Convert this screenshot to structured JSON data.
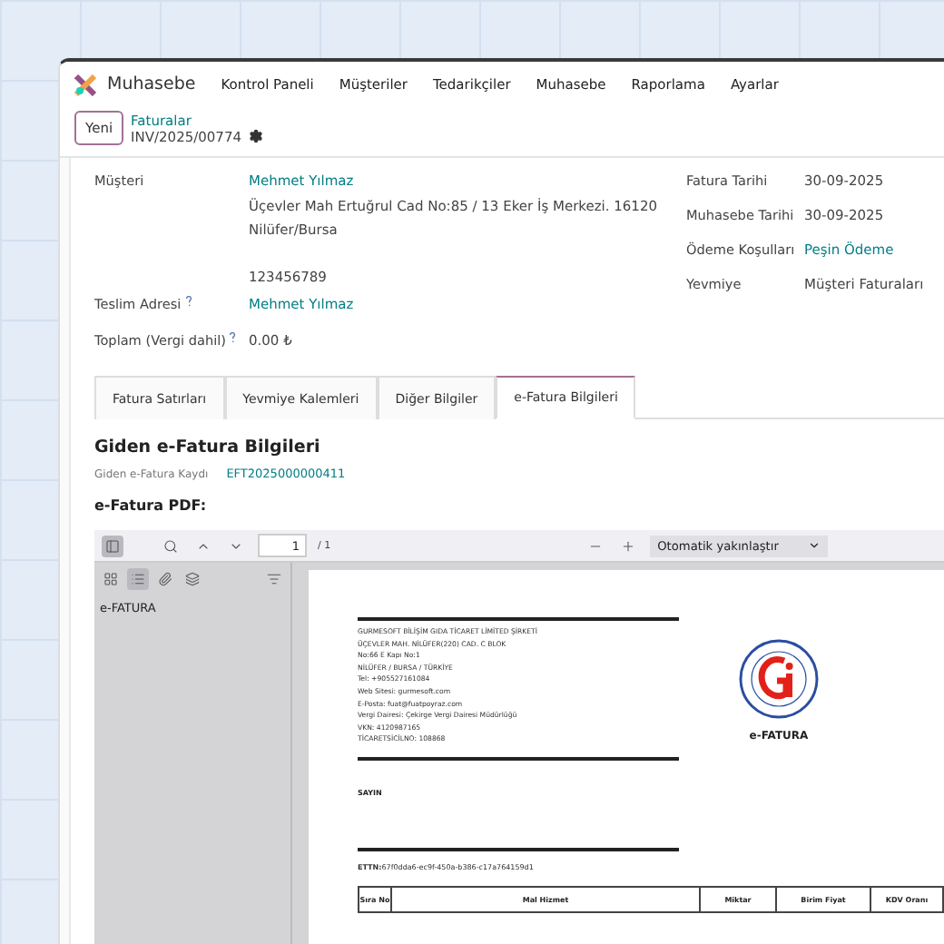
{
  "app": {
    "name": "Muhasebe",
    "menu": [
      "Kontrol Paneli",
      "Müşteriler",
      "Tedarikçiler",
      "Muhasebe",
      "Raporlama",
      "Ayarlar"
    ]
  },
  "breadcrumb": {
    "new_button": "Yeni",
    "parent": "Faturalar",
    "record": "INV/2025/00774"
  },
  "customer": {
    "label": "Müşteri",
    "name": "Mehmet Yılmaz",
    "address_lines": [
      "Üçevler Mah Ertuğrul Cad No:85 / 13 Eker İş Merkezi. 16120",
      "Nilüfer/Bursa"
    ],
    "phone": "123456789"
  },
  "left_fields": [
    {
      "label": "Teslim Adresi",
      "help": true,
      "kind": "link",
      "value": "Mehmet Yılmaz"
    },
    {
      "label": "Toplam (Vergi dahil)",
      "help": true,
      "kind": "text",
      "value": "0.00 ₺"
    }
  ],
  "right_fields": [
    {
      "label": "Fatura Tarihi",
      "kind": "text",
      "value": "30-09-2025"
    },
    {
      "label": "Muhasebe Tarihi",
      "kind": "text",
      "value": "30-09-2025"
    },
    {
      "label": "Ödeme Koşulları",
      "kind": "link",
      "value": "Peşin Ödeme"
    },
    {
      "label": "Yevmiye",
      "kind": "text",
      "value": "Müşteri Faturaları"
    }
  ],
  "tabs": [
    {
      "label": "Fatura Satırları",
      "selected": false
    },
    {
      "label": "Yevmiye Kalemleri",
      "selected": false
    },
    {
      "label": "Diğer Bilgiler",
      "selected": false
    },
    {
      "label": "e-Fatura Bilgileri",
      "selected": true
    }
  ],
  "section": {
    "title": "Giden e-Fatura Bilgileri",
    "record_label": "Giden e-Fatura Kaydı",
    "record_value": "EFT2025000000411",
    "pdf_label": "e-Fatura PDF:"
  },
  "pdf_viewer": {
    "sidebar_open": true,
    "page": "1",
    "page_total": "/ 1",
    "zoom": "Otomatik yakınlaştır",
    "sidebar_views": [
      {
        "kind": "thumbnails",
        "selected": false
      },
      {
        "kind": "outline",
        "selected": true
      },
      {
        "kind": "attachments",
        "selected": false
      },
      {
        "kind": "layers",
        "selected": false
      }
    ],
    "outline": [
      "e-FATURA"
    ]
  },
  "document": {
    "seller_lines": [
      "GURMESOFT BİLİŞİM GIDA TİCARET LİMİTED ŞİRKETİ",
      "ÜÇEVLER MAH. NİLÜFER(220) CAD. C BLOK",
      "No:66 E  Kapı No:1",
      "NİLÜFER / BURSA / TÜRKİYE",
      "Tel:  +905527161084",
      "Web Sitesi: gurmesoft.com",
      "E-Posta: fuat@fuatpoyraz.com",
      "Vergi Dairesi: Çekirge Vergi Dairesi Müdürlüğü",
      "VKN: 4120987165",
      "TİCARETSİCİLNO: 108868"
    ],
    "logo_caption": "e-FATURA",
    "recipient_heading": "SAYIN",
    "ettn_label": "ETTN:",
    "ettn": "67f0dda6-ec9f-450a-b386-c17a764159d1",
    "columns": [
      "Sıra No",
      "Mal Hizmet",
      "Miktar",
      "Birim Fiyat",
      "KDV Oranı"
    ]
  }
}
